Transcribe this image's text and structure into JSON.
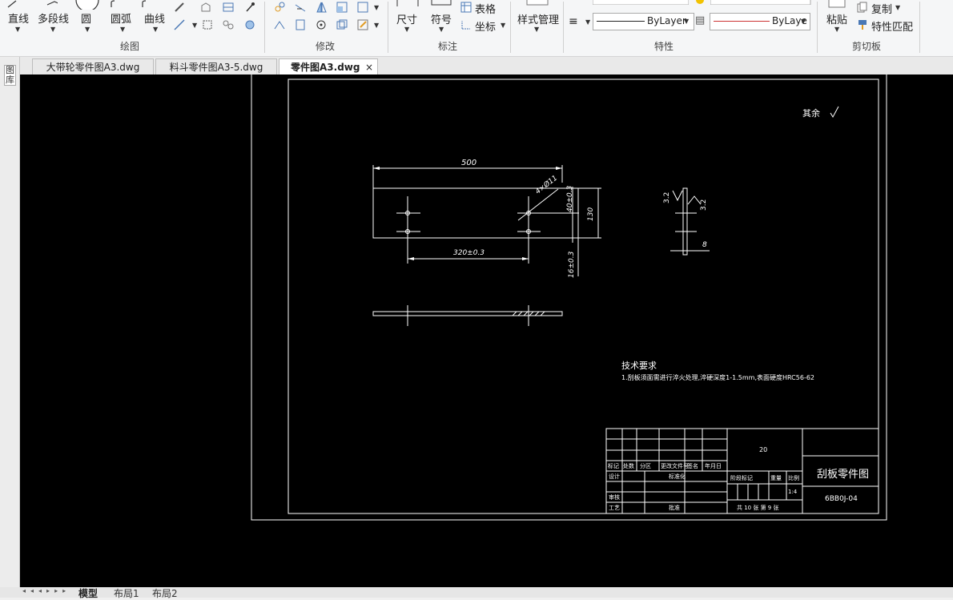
{
  "ribbon": {
    "draw_group": {
      "label": "绘图",
      "line": "直线",
      "polyline": "多段线",
      "circle": "圆",
      "arc": "圆弧",
      "curve": "曲线"
    },
    "modify_group": {
      "label": "修改"
    },
    "annotation_group": {
      "label": "标注",
      "dimension": "尺寸",
      "symbol": "符号",
      "table": "表格",
      "coordinate": "坐标"
    },
    "style_manager": "样式管理",
    "properties_group": {
      "label": "特性",
      "linetype_value": "ByLayer",
      "lineweight_value": "ByLaye"
    },
    "clipboard_group": {
      "label": "剪切板",
      "paste": "粘贴",
      "copy": "复制",
      "match_properties": "特性匹配"
    }
  },
  "tabs": [
    {
      "label": "大带轮零件图A3.dwg",
      "active": false
    },
    {
      "label": "料斗零件图A3-5.dwg",
      "active": false
    },
    {
      "label": "零件图A3.dwg",
      "active": true
    }
  ],
  "tab_close_glyph": "×",
  "left_palette": {
    "label": "图库"
  },
  "drawing": {
    "roughness_note": "其余",
    "dims": {
      "length": "500",
      "hole": "4×Ø11",
      "vertical_spacing": "40±0.3",
      "height": "130",
      "hole_spacing": "320±0.3",
      "bottom_offset": "16±0.3",
      "thickness": "8",
      "roughness_left": "3.2",
      "roughness_right": "3.2"
    },
    "tech_title": "技术要求",
    "tech_note": "1.刮板须面需进行淬火处理,淬硬深度1-1.5mm,表面硬度HRC56-62",
    "title_block": {
      "quantity": "20",
      "part_name": "刮板零件图",
      "drawing_no": "6BB0J-04",
      "scale": "1:4",
      "sheet_info": "共 10 张  第 9 张",
      "header_cols": [
        "标记",
        "处数",
        "分区",
        "更改文件号",
        "签名",
        "年月日"
      ],
      "row_design": "设计",
      "row_standard": "标准化",
      "row_check": "审核",
      "row_process": "工艺",
      "row_approve": "批准",
      "stage_cols": [
        "阶段标记",
        "重量",
        "比例"
      ]
    }
  },
  "layout_tabs": [
    "模型",
    "布局1",
    "布局2"
  ]
}
